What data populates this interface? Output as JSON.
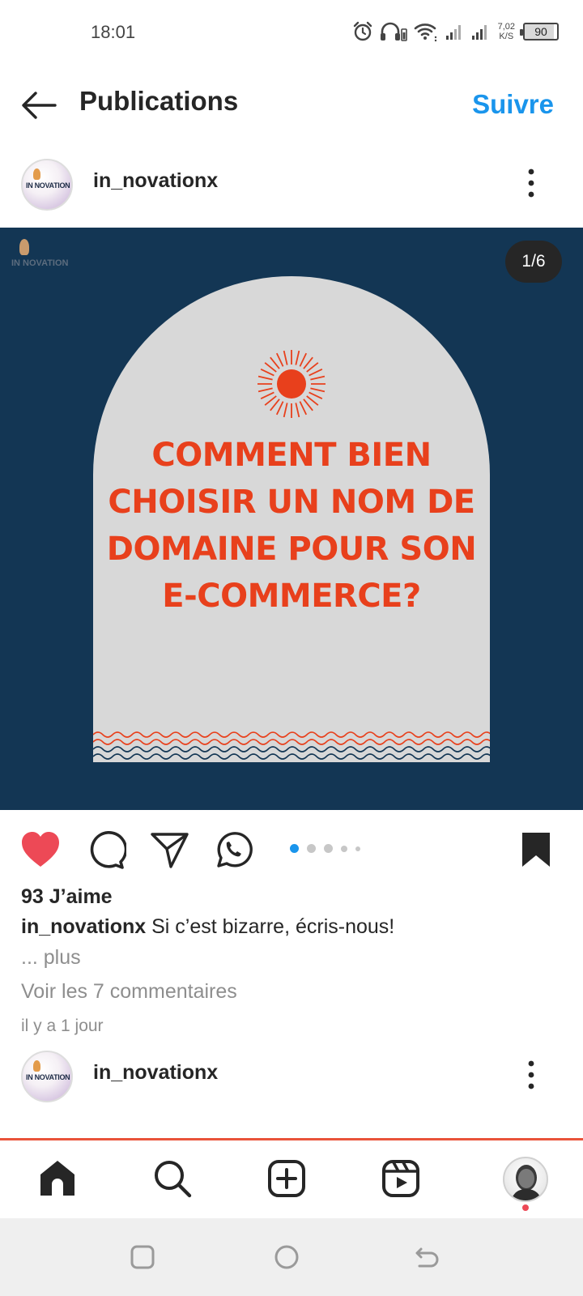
{
  "status_bar": {
    "time": "18:01",
    "net_speed_value": "7,02",
    "net_speed_unit": "K/S",
    "battery_level": "90",
    "icons": [
      "alarm-icon",
      "headphones-icon",
      "wifi-icon",
      "signal-icon",
      "signal-icon"
    ]
  },
  "header": {
    "title": "Publications",
    "follow_label": "Suivre",
    "back_icon": "arrow-left-icon"
  },
  "post": {
    "username": "in_novationx",
    "avatar_text": "IN NOVATION",
    "slide_counter": "1/6",
    "slide_count": 6,
    "current_slide": 1,
    "image": {
      "watermark": "IN NOVATION",
      "headline_lines": [
        "COMMENT BIEN",
        "CHOISIR UN NOM DE",
        "DOMAINE POUR SON",
        "E-COMMERCE?"
      ],
      "background_color": "#133654",
      "arch_color": "#d8d8d8",
      "accent_color": "#e8401c"
    },
    "liked": true,
    "likes": "93 J’aime",
    "caption_username": "in_novationx",
    "caption_text": " Si c’est bizarre, écris-nous!",
    "more_label": "... plus",
    "comments_label": "Voir les 7 commentaires",
    "timestamp": "il y a 1 jour"
  },
  "next_post": {
    "username": "in_novationx",
    "avatar_text": "IN NOVATION"
  },
  "colors": {
    "link_blue": "#1a95ec",
    "like_red": "#ed4956",
    "muted_gray": "#8e8e8e",
    "active_dot": "#1a95ec"
  },
  "bottom_nav": {
    "items": [
      "home-icon",
      "search-icon",
      "create-icon",
      "reels-icon",
      "profile-avatar"
    ],
    "active": "home-icon"
  },
  "android_nav": [
    "recents-icon",
    "home-circle-icon",
    "back-icon"
  ]
}
